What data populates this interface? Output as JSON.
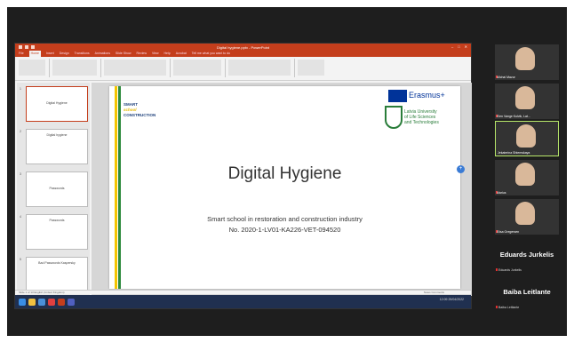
{
  "app": {
    "window_title": "Digital hygiene.pptx - PowerPoint",
    "ribbon_tabs": [
      "File",
      "Home",
      "Insert",
      "Design",
      "Transitions",
      "Animations",
      "Slide Show",
      "Review",
      "View",
      "Help",
      "Acrobat",
      "Tell me what you want to do"
    ],
    "active_tab": "Home"
  },
  "slides": [
    {
      "num": "1",
      "title": "Digital Hygiene"
    },
    {
      "num": "2",
      "title": "Digital hygiene"
    },
    {
      "num": "3",
      "title": "Passwords"
    },
    {
      "num": "4",
      "title": "Passwords"
    },
    {
      "num": "5",
      "title": "Bad Passwords Kaspersky"
    }
  ],
  "slide": {
    "logo_line1": "SMART",
    "logo_line2": "school",
    "logo_line3": "CONSTRUCTION",
    "erasmus": "Erasmus+",
    "university": [
      "Latvia University",
      "of Life Sciences",
      "and Technologies"
    ],
    "title": "Digital Hygiene",
    "subtitle1": "Smart school in restoration and construction industry",
    "subtitle2": "No. 2020-1-LV01-KA226-VET-094520"
  },
  "status": {
    "left": "Slide 1 of 13    English (United Kingdom)",
    "right": "Notes  Comments"
  },
  "participants": [
    {
      "name": "Michal Mazur",
      "speaking": false
    },
    {
      "name": "Elen Vange Kulvik, Lat...",
      "speaking": false
    },
    {
      "name": "Jekaterina Shtemskaya",
      "speaking": true
    },
    {
      "name": "Marius",
      "speaking": false
    },
    {
      "name": "Elisa Gregersen",
      "speaking": false
    }
  ],
  "named_tiles": [
    {
      "big": "Eduards Jurkelis",
      "small": "Eduards Jurkelis"
    },
    {
      "big": "Baiba Leitlante",
      "small": "Baiba Leitlante"
    }
  ],
  "tray": {
    "time": "12:09",
    "date": "29/04/2022"
  },
  "colors": {
    "ppt_red": "#c43e1c",
    "erasmus_blue": "#003399",
    "llu_green": "#2a7d3a",
    "speaker_border": "#b8e86a"
  }
}
